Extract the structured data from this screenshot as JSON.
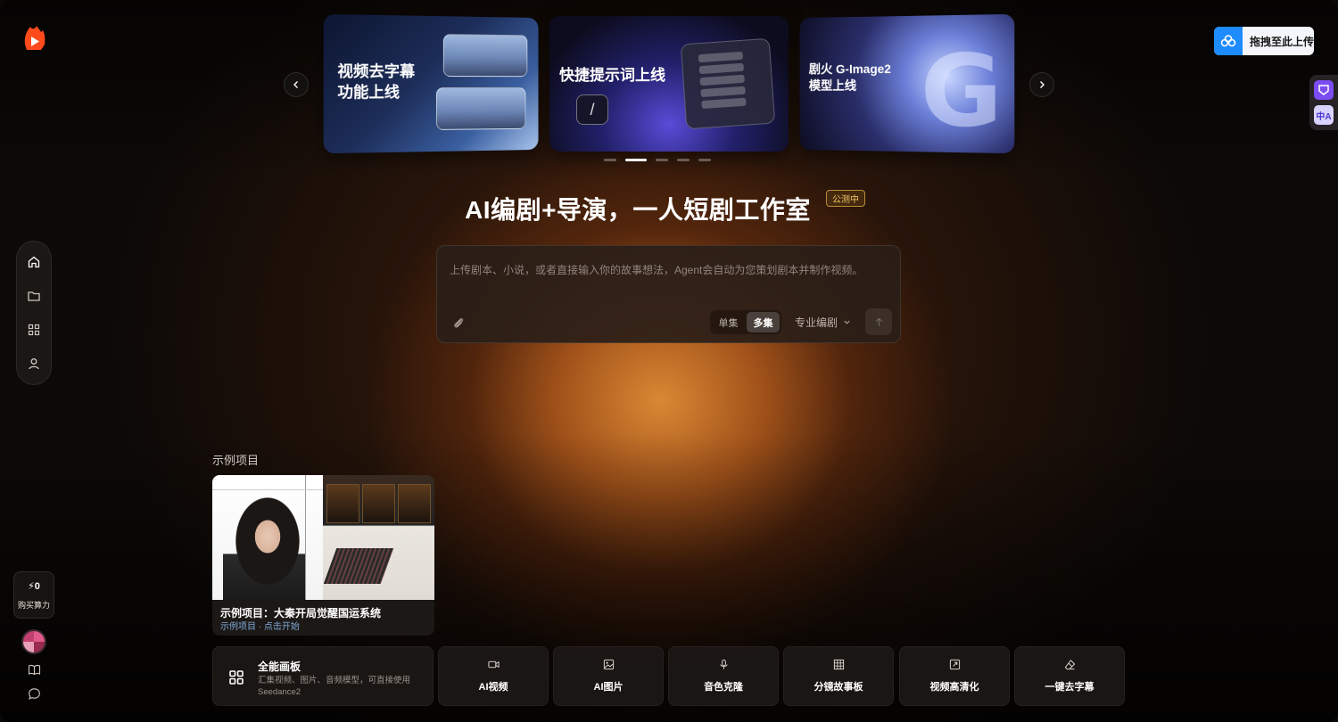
{
  "app": {
    "name": "剧火"
  },
  "carousel": {
    "slides": [
      {
        "title_line1": "视频去字幕",
        "title_line2": "功能上线"
      },
      {
        "title_line1": "快捷提示词上线"
      },
      {
        "title_line1": "剧火 G-Image2",
        "title_line2": "模型上线"
      }
    ],
    "active_index": 1,
    "slide_count": 5
  },
  "upload_button": {
    "label": "拖拽至此上传"
  },
  "extension": {
    "translate_label": "中A"
  },
  "hero": {
    "title": "AI编剧+导演，一人短剧工作室",
    "badge": "公测中"
  },
  "prompt": {
    "placeholder": "上传剧本、小说，或者直接输入你的故事想法，Agent会自动为您策划剧本并制作视频。",
    "modes": [
      "单集",
      "多集"
    ],
    "active_mode": "多集",
    "writer_select": "专业编剧"
  },
  "sidebar": {
    "items": [
      "home",
      "folder",
      "apps",
      "user"
    ],
    "credits": {
      "value": "0",
      "label": "购买算力"
    }
  },
  "samples": {
    "section_label": "示例项目",
    "items": [
      {
        "title": "示例项目：大秦开局觉醒国运系统",
        "subtitle": "示例项目 · 点击开始"
      }
    ]
  },
  "tools": {
    "main": {
      "title": "全能画板",
      "description": "汇集视频、图片、音频模型，可直接使用Seedance2"
    },
    "items": [
      {
        "label": "AI视频",
        "icon": "video-icon"
      },
      {
        "label": "AI图片",
        "icon": "image-icon"
      },
      {
        "label": "音色克隆",
        "icon": "mic-icon"
      },
      {
        "label": "分镜故事板",
        "icon": "grid-icon"
      },
      {
        "label": "视频高清化",
        "icon": "enhance-icon"
      },
      {
        "label": "一键去字幕",
        "icon": "eraser-icon"
      }
    ]
  },
  "colors": {
    "accent_orange": "#e28e36",
    "badge_gold": "#f0c56a",
    "upload_blue": "#1e8bff"
  }
}
